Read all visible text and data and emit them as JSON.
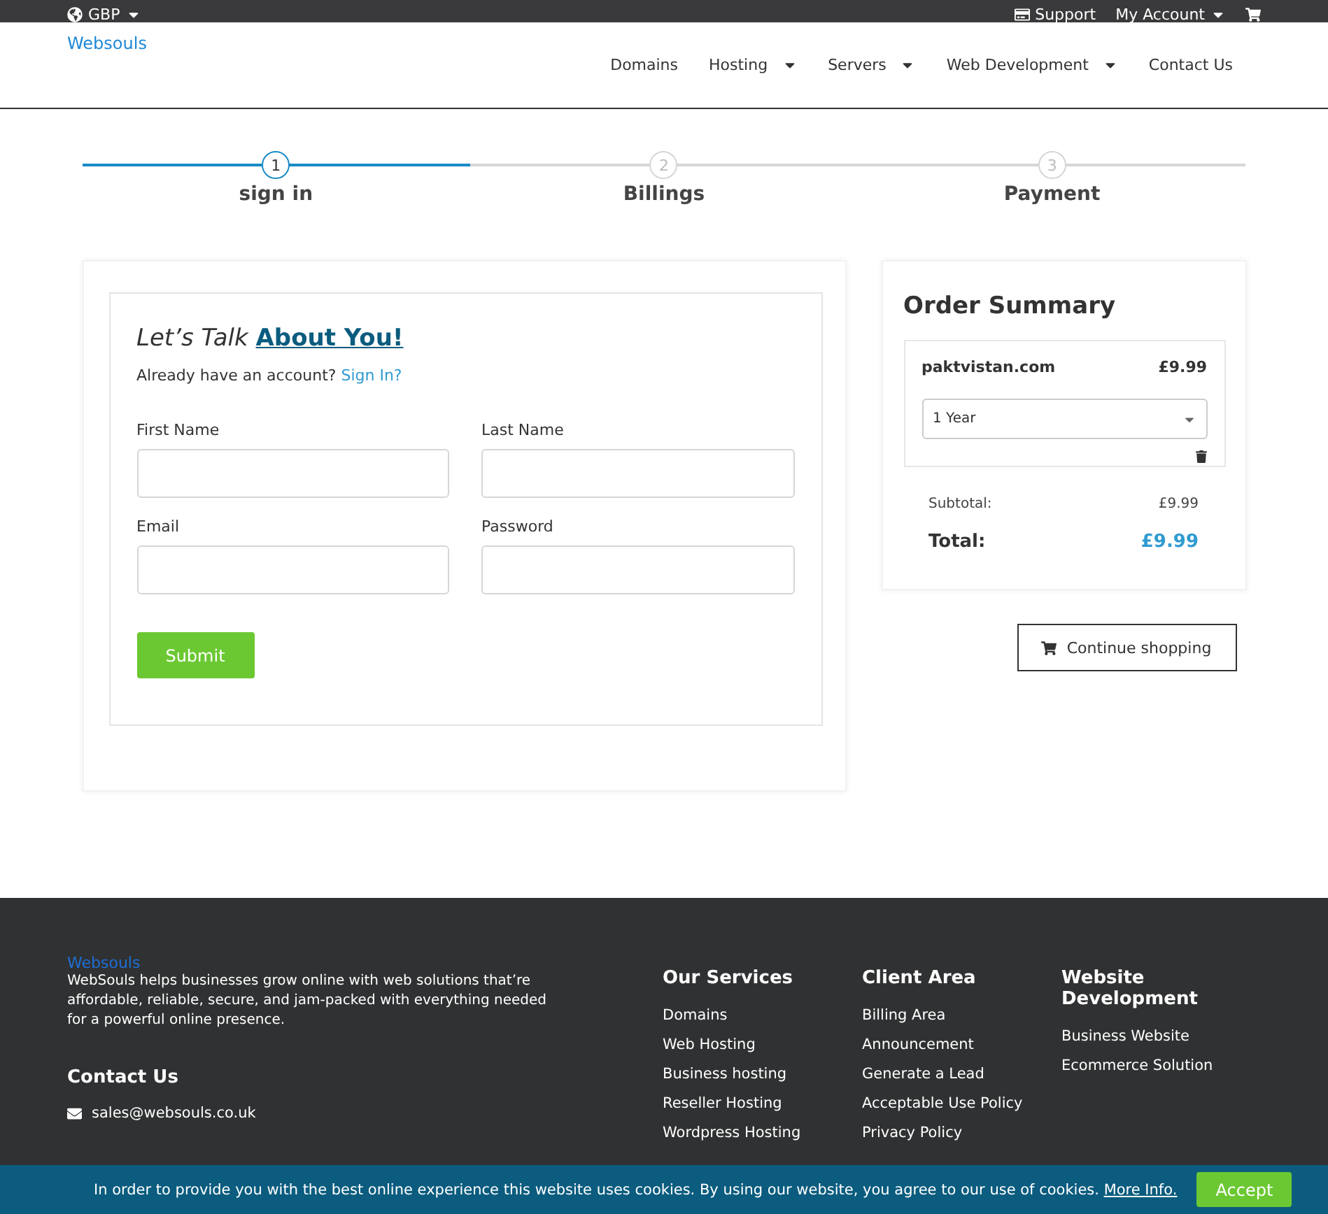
{
  "topbar": {
    "currency": "GBP",
    "links": [
      "Support",
      "My Account"
    ]
  },
  "header": {
    "logo": "Websouls",
    "nav": [
      {
        "label": "Domains",
        "dropdown": false
      },
      {
        "label": "Hosting",
        "dropdown": true
      },
      {
        "label": "Servers",
        "dropdown": true
      },
      {
        "label": "Web Development",
        "dropdown": true
      },
      {
        "label": "Contact Us",
        "dropdown": false
      }
    ]
  },
  "steps": [
    {
      "number": "1",
      "label": "sign in",
      "selected": true
    },
    {
      "number": "2",
      "label": "Billings",
      "selected": false
    },
    {
      "number": "3",
      "label": "Payment",
      "selected": false
    }
  ],
  "form": {
    "title_lead": "Let’s Talk",
    "title_link": "About You!",
    "account_text": "Already have an account?",
    "account_link": "Sign In?",
    "fields": [
      {
        "label": "First Name"
      },
      {
        "label": "Last Name"
      },
      {
        "label": "Email"
      },
      {
        "label": "Password"
      }
    ],
    "submit": "Submit"
  },
  "summary": {
    "title": "Order Summary",
    "item": {
      "domain": "paktvistan.com",
      "price": "£9.99",
      "period": "1 Year"
    },
    "subtotal_label": "Subtotal:",
    "subtotal": "£9.99",
    "total_label": "Total:",
    "total": "£9.99",
    "continue": "Continue shopping"
  },
  "footer": {
    "brand": "Websouls",
    "about": "WebSouls helps businesses grow online with web solutions that’re affordable, reliable, secure, and jam-packed with everything needed for a powerful online presence.",
    "contact_title": "Contact Us",
    "email": "sales@websouls.co.uk",
    "columns": [
      {
        "title": "Our Services",
        "links": [
          "Domains",
          "Web Hosting",
          "Business hosting",
          "Reseller Hosting",
          "Wordpress Hosting"
        ]
      },
      {
        "title": "Client Area",
        "links": [
          "Billing Area",
          "Announcement",
          "Generate a Lead",
          "Acceptable Use Policy",
          "Privacy Policy"
        ]
      },
      {
        "title": "Website Development",
        "links": [
          "Business Website",
          "Ecommerce Solution"
        ]
      }
    ]
  },
  "cookie": {
    "text": "In order to provide you with the best online experience this website uses cookies. By using our website, you agree to our use of cookies.",
    "link": "More Info.",
    "accept": "Accept"
  }
}
